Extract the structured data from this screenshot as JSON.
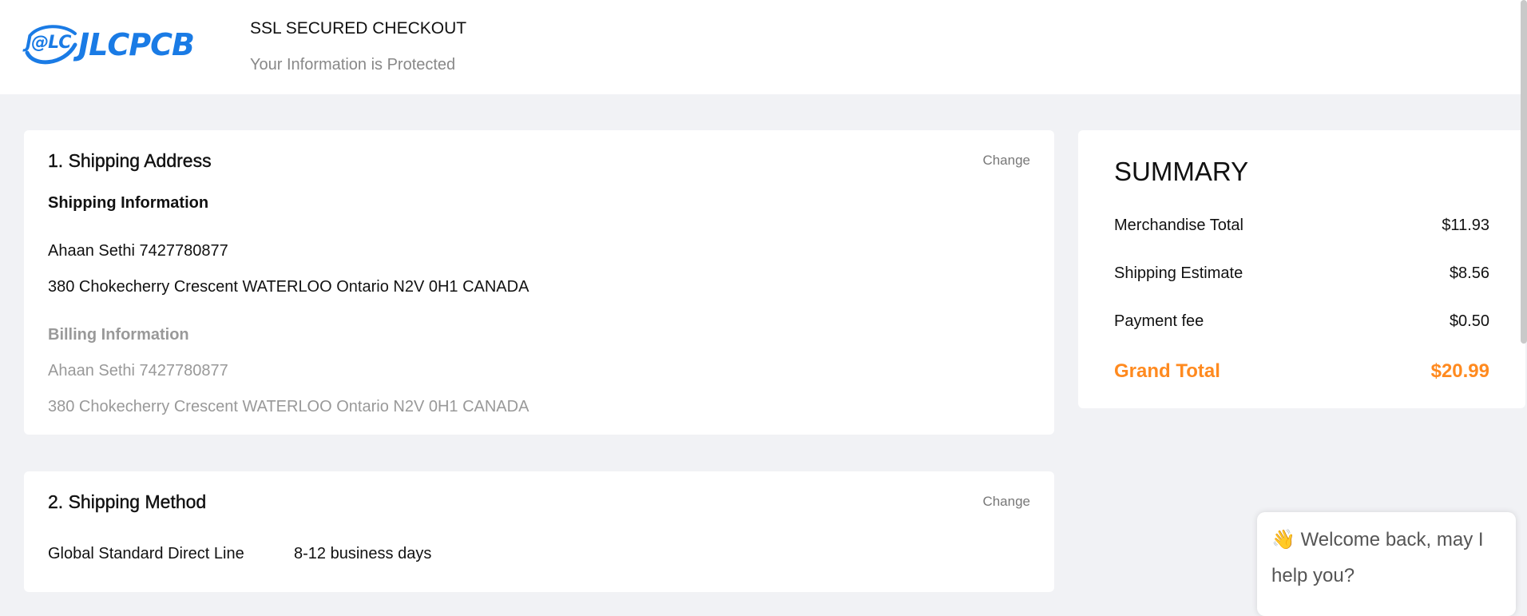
{
  "header": {
    "logo_mark": "J@LC",
    "logo_text": "JLCPCB",
    "ssl_title": "SSL SECURED CHECKOUT",
    "ssl_subtitle": "Your Information is Protected"
  },
  "shipping_address": {
    "title": "1. Shipping Address",
    "change_label": "Change",
    "shipping_info_heading": "Shipping Information",
    "shipping_name_phone": "Ahaan Sethi 7427780877",
    "shipping_address_line": "380 Chokecherry Crescent WATERLOO Ontario N2V 0H1 CANADA",
    "billing_info_heading": "Billing Information",
    "billing_name_phone": "Ahaan Sethi 7427780877",
    "billing_address_line": "380 Chokecherry Crescent WATERLOO Ontario N2V 0H1 CANADA"
  },
  "shipping_method": {
    "title": "2. Shipping Method",
    "change_label": "Change",
    "method_name": "Global Standard Direct Line",
    "method_days": "8-12 business days"
  },
  "summary": {
    "title": "SUMMARY",
    "rows": [
      {
        "label": "Merchandise Total",
        "value": "$11.93"
      },
      {
        "label": "Shipping Estimate",
        "value": "$8.56"
      },
      {
        "label": "Payment fee",
        "value": "$0.50"
      }
    ],
    "grand_total_label": "Grand Total",
    "grand_total_value": "$20.99"
  },
  "chat": {
    "icon": "waving-hand-icon",
    "message": "Welcome back, may I help you?"
  },
  "colors": {
    "brand_blue": "#1a7be5",
    "grand_total_orange": "#ff8a1f",
    "page_background": "#f1f2f5"
  }
}
